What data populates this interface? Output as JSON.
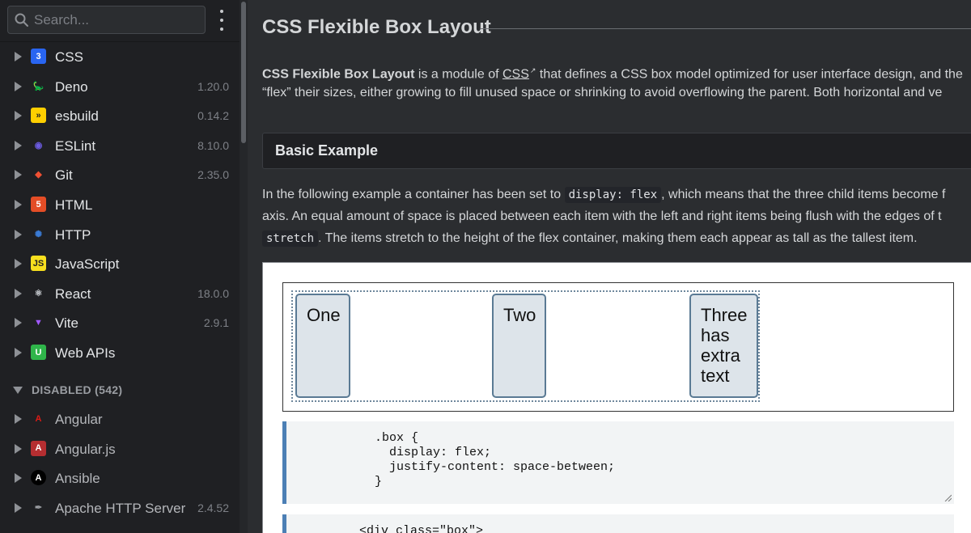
{
  "sidebar": {
    "search_placeholder": "Search...",
    "enabled_items": [
      {
        "name": "CSS",
        "version": "",
        "icon": "css-icon",
        "color": "#2965f1"
      },
      {
        "name": "Deno",
        "version": "1.20.0",
        "icon": "deno-icon",
        "color": "#ffffff"
      },
      {
        "name": "esbuild",
        "version": "0.14.2",
        "icon": "esbuild-icon",
        "color": "#ffcf00"
      },
      {
        "name": "ESLint",
        "version": "8.10.0",
        "icon": "eslint-icon",
        "color": "#4b32c3"
      },
      {
        "name": "Git",
        "version": "2.35.0",
        "icon": "git-icon",
        "color": "#f05033"
      },
      {
        "name": "HTML",
        "version": "",
        "icon": "html-icon",
        "color": "#e44d26"
      },
      {
        "name": "HTTP",
        "version": "",
        "icon": "http-icon",
        "color": "#3a7bd5"
      },
      {
        "name": "JavaScript",
        "version": "",
        "icon": "javascript-icon",
        "color": "#f7df1e"
      },
      {
        "name": "React",
        "version": "18.0.0",
        "icon": "react-icon",
        "color": "#cfd3d8"
      },
      {
        "name": "Vite",
        "version": "2.9.1",
        "icon": "vite-icon",
        "color": "#a259ff"
      },
      {
        "name": "Web APIs",
        "version": "",
        "icon": "web-apis-icon",
        "color": "#2fb54a"
      }
    ],
    "disabled_header": "DISABLED (542)",
    "disabled_items": [
      {
        "name": "Angular",
        "version": "",
        "icon": "angular-icon",
        "color": "#dd1b16"
      },
      {
        "name": "Angular.js",
        "version": "",
        "icon": "angularjs-icon",
        "color": "#b52e31"
      },
      {
        "name": "Ansible",
        "version": "",
        "icon": "ansible-icon",
        "color": "#ffffff"
      },
      {
        "name": "Apache HTTP Server",
        "version": "2.4.52",
        "icon": "apache-feather-icon",
        "color": "#9a9da2"
      }
    ]
  },
  "main": {
    "title": "CSS Flexible Box Layout",
    "intro": {
      "strong": "CSS Flexible Box Layout",
      "t1": " is a module of ",
      "link": "CSS",
      "t2": " that defines a CSS box model optimized for user interface design, and the",
      "line2": "“flex” their sizes, either growing to fill unused space or shrinking to avoid overflowing the parent. Both horizontal and ve"
    },
    "section_title": "Basic Example",
    "example": {
      "p1a": "In the following example a container has been set to ",
      "code1": "display: flex",
      "p1b": ", which means that the three child items become f",
      "p2": "axis. An equal amount of space is placed between each item with the left and right items being flush with the edges of t",
      "code2": "stretch",
      "p3": ". The items stretch to the height of the flex container, making them each appear as tall as the tallest item."
    },
    "demo_items": [
      "One",
      "Two",
      "Three has extra text"
    ],
    "css_code": ".box {\n  display: flex;\n  justify-content: space-between;\n}",
    "html_code": "<div class=\"box\">"
  }
}
